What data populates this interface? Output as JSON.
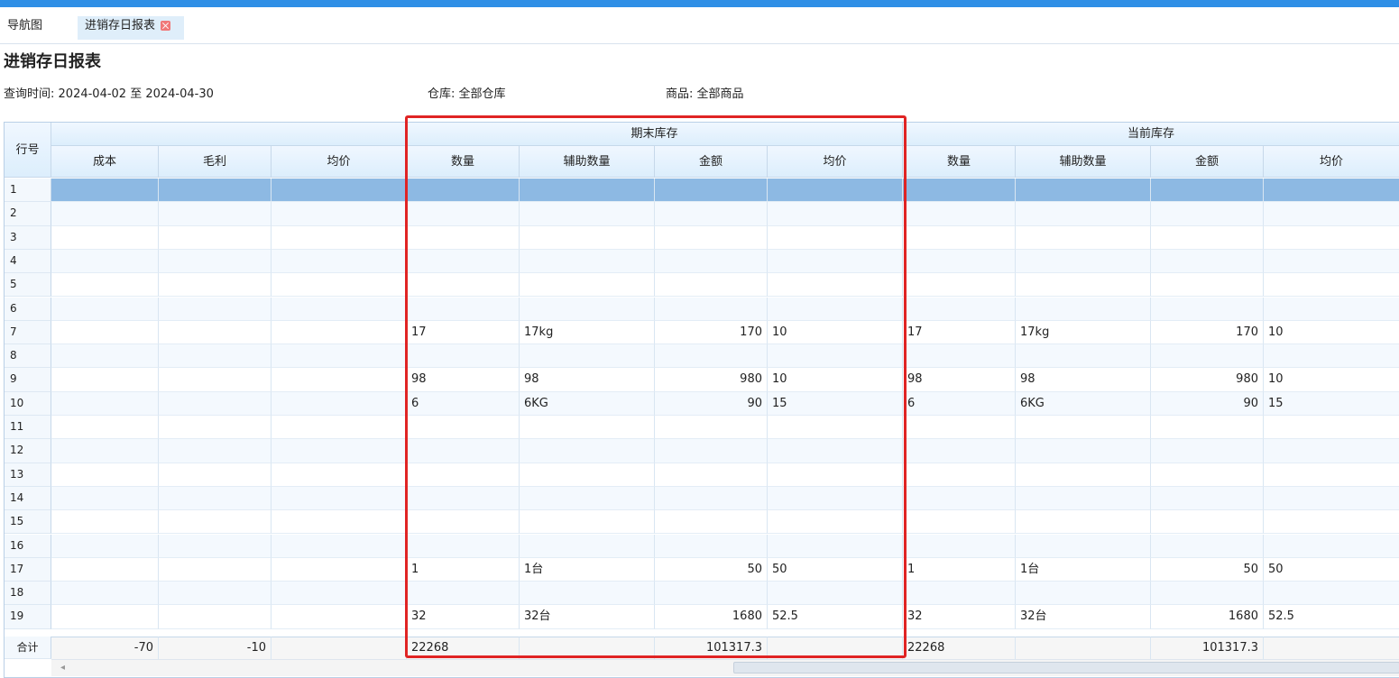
{
  "tabs": [
    {
      "label": "导航图"
    },
    {
      "label": "进销存日报表"
    }
  ],
  "page": {
    "title": "进销存日报表"
  },
  "filters": {
    "time_label": "查询时间:",
    "time_value": "2024-04-02 至 2024-04-30",
    "warehouse_label": "仓库:",
    "warehouse_value": "全部仓库",
    "goods_label": "商品:",
    "goods_value": "全部商品"
  },
  "table": {
    "row_no_header": "行号",
    "group_headers": [
      "期末库存",
      "当前库存"
    ],
    "columns": [
      "成本",
      "毛利",
      "均价",
      "数量",
      "辅助数量",
      "金额",
      "均价",
      "数量",
      "辅助数量",
      "金额",
      "均价"
    ],
    "rows": [
      {
        "no": "1",
        "cells": [
          "",
          "",
          "",
          "",
          "",
          "",
          "",
          "",
          "",
          "",
          ""
        ]
      },
      {
        "no": "2",
        "cells": [
          "",
          "",
          "",
          "",
          "",
          "",
          "",
          "",
          "",
          "",
          ""
        ]
      },
      {
        "no": "3",
        "cells": [
          "",
          "",
          "",
          "",
          "",
          "",
          "",
          "",
          "",
          "",
          ""
        ]
      },
      {
        "no": "4",
        "cells": [
          "",
          "",
          "",
          "",
          "",
          "",
          "",
          "",
          "",
          "",
          ""
        ]
      },
      {
        "no": "5",
        "cells": [
          "",
          "",
          "",
          "",
          "",
          "",
          "",
          "",
          "",
          "",
          ""
        ]
      },
      {
        "no": "6",
        "cells": [
          "",
          "",
          "",
          "",
          "",
          "",
          "",
          "",
          "",
          "",
          ""
        ]
      },
      {
        "no": "7",
        "cells": [
          "",
          "",
          "",
          "17",
          "17kg",
          "170",
          "10",
          "17",
          "17kg",
          "170",
          "10"
        ]
      },
      {
        "no": "8",
        "cells": [
          "",
          "",
          "",
          "",
          "",
          "",
          "",
          "",
          "",
          "",
          ""
        ]
      },
      {
        "no": "9",
        "cells": [
          "",
          "",
          "",
          "98",
          "98",
          "980",
          "10",
          "98",
          "98",
          "980",
          "10"
        ]
      },
      {
        "no": "10",
        "cells": [
          "",
          "",
          "",
          "6",
          "6KG",
          "90",
          "15",
          "6",
          "6KG",
          "90",
          "15"
        ]
      },
      {
        "no": "11",
        "cells": [
          "",
          "",
          "",
          "",
          "",
          "",
          "",
          "",
          "",
          "",
          ""
        ]
      },
      {
        "no": "12",
        "cells": [
          "",
          "",
          "",
          "",
          "",
          "",
          "",
          "",
          "",
          "",
          ""
        ]
      },
      {
        "no": "13",
        "cells": [
          "",
          "",
          "",
          "",
          "",
          "",
          "",
          "",
          "",
          "",
          ""
        ]
      },
      {
        "no": "14",
        "cells": [
          "",
          "",
          "",
          "",
          "",
          "",
          "",
          "",
          "",
          "",
          ""
        ]
      },
      {
        "no": "15",
        "cells": [
          "",
          "",
          "",
          "",
          "",
          "",
          "",
          "",
          "",
          "",
          ""
        ]
      },
      {
        "no": "16",
        "cells": [
          "",
          "",
          "",
          "",
          "",
          "",
          "",
          "",
          "",
          "",
          ""
        ]
      },
      {
        "no": "17",
        "cells": [
          "",
          "",
          "",
          "1",
          "1台",
          "50",
          "50",
          "1",
          "1台",
          "50",
          "50"
        ]
      },
      {
        "no": "18",
        "cells": [
          "",
          "",
          "",
          "",
          "",
          "",
          "",
          "",
          "",
          "",
          ""
        ]
      },
      {
        "no": "19",
        "cells": [
          "",
          "",
          "",
          "32",
          "32台",
          "1680",
          "52.5",
          "32",
          "32台",
          "1680",
          "52.5"
        ]
      }
    ],
    "footer": {
      "label": "合计",
      "cells": [
        "-70",
        "-10",
        "",
        "22268",
        "",
        "101317.3",
        "",
        "22268",
        "",
        "101317.3",
        ""
      ]
    }
  },
  "colors": {
    "topbar": "#2f8fe6",
    "highlight": "#e02424",
    "selected_row": "#8db9e3"
  },
  "icons": {
    "tab_close": "close-icon",
    "scroll_left": "chevron-left-icon"
  }
}
